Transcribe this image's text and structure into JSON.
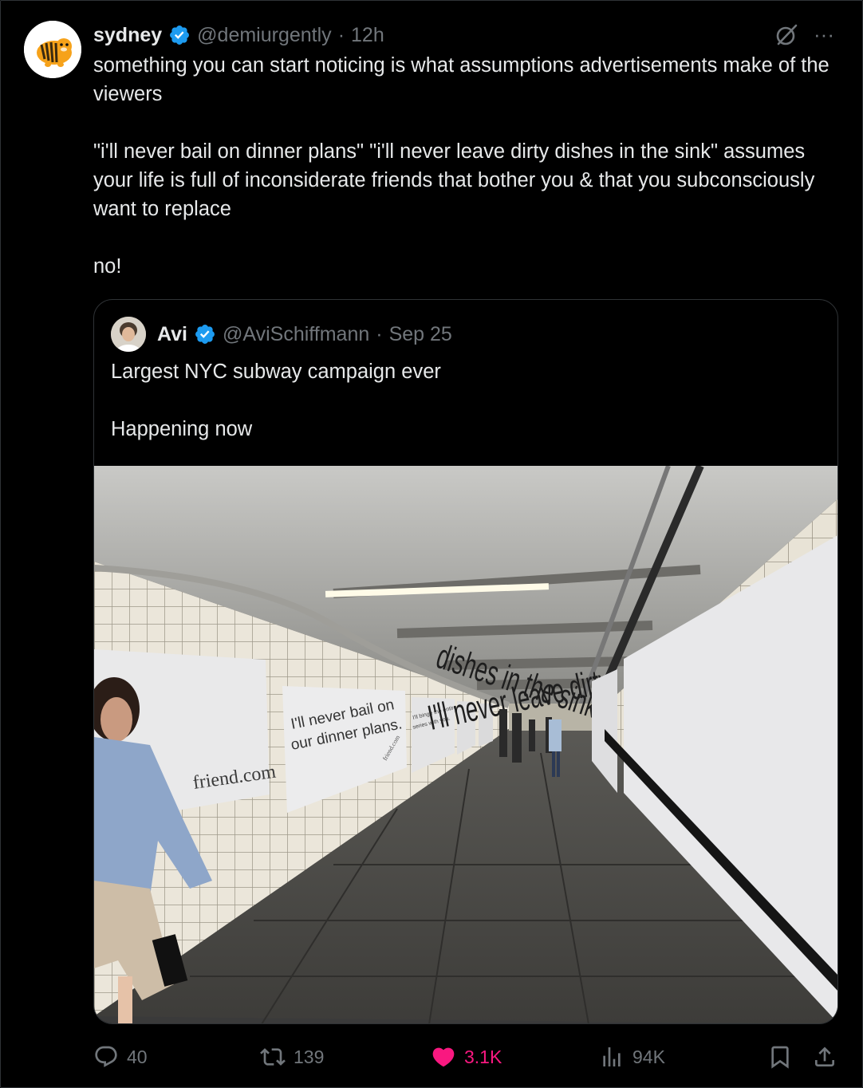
{
  "tweet": {
    "display_name": "sydney",
    "handle": "@demiurgently",
    "dot": "·",
    "time": "12h",
    "text": [
      "something you can start noticing is what assumptions advertisements make of the viewers",
      "\"i'll never bail on dinner plans\" \"i'll never leave dirty dishes in the sink\" assumes your life is full of inconsiderate friends that bother you & that you subconsciously want to replace",
      "no!"
    ]
  },
  "quote": {
    "display_name": "Avi",
    "handle": "@AviSchiffmann",
    "dot": "·",
    "date": "Sep 25",
    "text": [
      "Largest NYC subway campaign ever",
      "Happening now"
    ],
    "image": {
      "ads": {
        "left": "friend.com",
        "middle_line1": "I'll never bail on",
        "middle_line2": "our dinner plans.",
        "middle_small": "friend.com",
        "small_line1": "I'll binge the entire",
        "small_line2": "series with you.",
        "right_line1": "I'll never leave dirty",
        "right_line2": "dishes in the sink."
      }
    }
  },
  "actions": {
    "replies": "40",
    "reposts": "139",
    "likes": "3.1K",
    "views": "94K"
  },
  "icons": {
    "reply": "reply-icon",
    "repost": "repost-icon",
    "like": "heart-icon",
    "views": "views-icon",
    "bookmark": "bookmark-icon",
    "share": "share-icon",
    "verified": "verified-icon",
    "grok": "grok-icon",
    "more": "more-icon"
  },
  "colors": {
    "background": "#000000",
    "text": "#e7e9ea",
    "muted": "#71767b",
    "verified": "#1d9bf0",
    "like": "#f91880",
    "border": "#2f3336"
  }
}
